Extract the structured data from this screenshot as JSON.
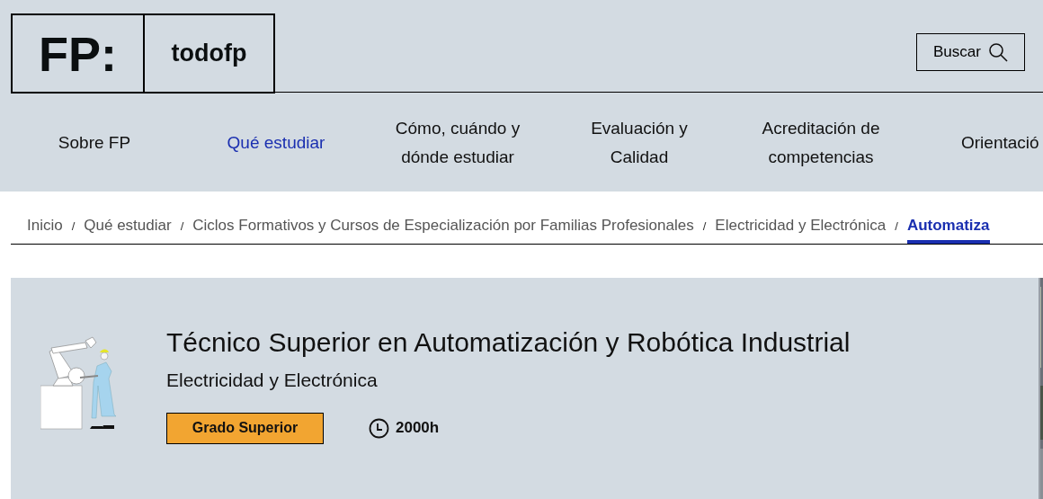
{
  "header": {
    "logo_mark": "FP:",
    "logo_name": "todofp",
    "search_button": "Buscar"
  },
  "nav": [
    {
      "label": "Sobre FP",
      "selected": false
    },
    {
      "label": "Qué estudiar",
      "selected": true
    },
    {
      "label": "Cómo, cuándo y dónde estudiar",
      "selected": false
    },
    {
      "label": "Evaluación y Calidad",
      "selected": false
    },
    {
      "label": "Acreditación de competencias",
      "selected": false
    },
    {
      "label": "Orientació",
      "selected": false
    }
  ],
  "breadcrumb": [
    {
      "label": "Inicio",
      "selected": false
    },
    {
      "label": "Qué estudiar",
      "selected": false
    },
    {
      "label": "Ciclos Formativos y Cursos de Especialización por Familias Profesionales",
      "selected": false
    },
    {
      "label": "Electricidad y Electrónica",
      "selected": false
    },
    {
      "label": "Automatiza",
      "selected": true
    }
  ],
  "breadcrumb_separator": "/",
  "course": {
    "title": "Técnico Superior en Automatización y Robótica Industrial",
    "family": "Electricidad y Electrónica",
    "level": "Grado Superior",
    "duration": "2000h"
  }
}
